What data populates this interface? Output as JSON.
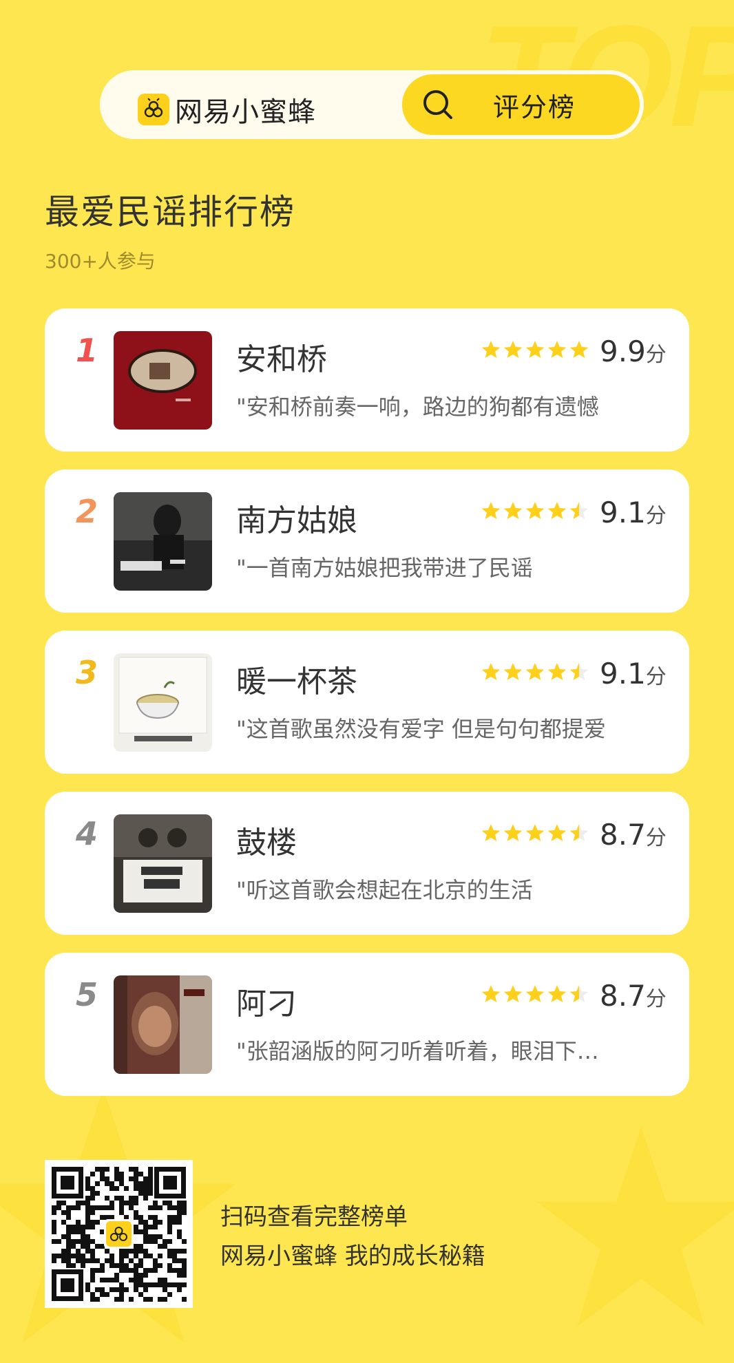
{
  "header": {
    "brand_name": "网易小蜜蜂",
    "search_label": "评分榜"
  },
  "page": {
    "title": "最爱民谣排行榜",
    "participants": "300+人参与"
  },
  "ranks": [
    {
      "rank": "1",
      "rank_color": "#f0524f",
      "title": "安和桥",
      "rating": 5.0,
      "score": "9.9",
      "unit": "分",
      "quote": "\"安和桥前奏一响，路边的狗都有遗憾"
    },
    {
      "rank": "2",
      "rank_color": "#f2955a",
      "title": "南方姑娘",
      "rating": 4.5,
      "score": "9.1",
      "unit": "分",
      "quote": "\"一首南方姑娘把我带进了民谣"
    },
    {
      "rank": "3",
      "rank_color": "#f2b91c",
      "title": "暖一杯茶",
      "rating": 4.5,
      "score": "9.1",
      "unit": "分",
      "quote": "\"这首歌虽然没有爱字 但是句句都提爱"
    },
    {
      "rank": "4",
      "rank_color": "#8a8a8a",
      "title": "鼓楼",
      "rating": 4.5,
      "score": "8.7",
      "unit": "分",
      "quote": "\"听这首歌会想起在北京的生活"
    },
    {
      "rank": "5",
      "rank_color": "#8a8a8a",
      "title": "阿刁",
      "rating": 4.5,
      "score": "8.7",
      "unit": "分",
      "quote": "\"张韶涵版的阿刁听着听着，眼泪下…"
    }
  ],
  "footer": {
    "line1": "扫码查看完整榜单",
    "line2": "网易小蜜蜂 我的成长秘籍"
  },
  "colors": {
    "background": "#fde64f",
    "star_filled": "#fdd11b",
    "star_empty": "#eeeeee"
  },
  "icons": {
    "brand": "bee-logo-icon",
    "search": "search-icon",
    "star": "star-icon",
    "qr": "qr-code"
  }
}
